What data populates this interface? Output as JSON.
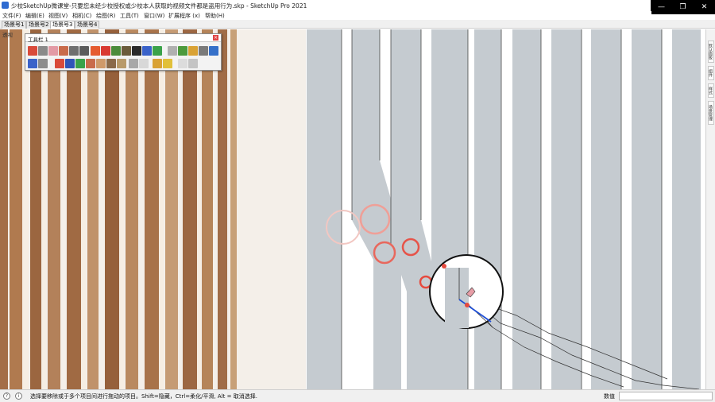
{
  "window": {
    "title": "少校SketchUp微课堂-只要您未经少校授权或少校本人获取的视频文件都是盗用行为.skp - SketchUp Pro 2021",
    "controls": {
      "minimize": "—",
      "restore": "❐",
      "close": "✕"
    }
  },
  "menu": [
    "文件(F)",
    "编辑(E)",
    "视图(V)",
    "相机(C)",
    "绘图(R)",
    "工具(T)",
    "窗口(W)",
    "扩展程序 (x)",
    "帮助(H)"
  ],
  "scene_tabs": [
    {
      "label": "场景号1",
      "active": false
    },
    {
      "label": "场景号2",
      "active": false
    },
    {
      "label": "场景号3",
      "active": true
    },
    {
      "label": "场景号4",
      "active": false
    }
  ],
  "viewport": {
    "perspective_label": "透视"
  },
  "tool_palette": {
    "title": "工具栏 1",
    "close": "×",
    "row1": [
      "select-icon",
      "arc-icon",
      "eraser-icon",
      "paint-icon",
      "rotate-icon",
      "rectangle-icon",
      "push-pull-icon",
      "move-icon",
      "follow-me-icon",
      "offset-icon",
      "tape-icon",
      "protractor-icon",
      "axes-icon",
      "dimension-icon",
      "text-icon",
      "section-icon",
      "orbit-icon",
      "pan-icon"
    ],
    "row2": [
      "component-icon",
      "group-icon",
      "freehand-icon",
      "flip-icon",
      "scale-icon",
      "sandbox-icon",
      "smoove-icon",
      "stamp-icon",
      "drape-icon",
      "add-detail-icon",
      "flip-edge-icon",
      "zoom-extents-icon",
      "style-icon",
      "layers-icon",
      "materials-icon"
    ]
  },
  "right_panel_tabs": [
    "默认面板",
    "组件",
    "样式",
    "场景管理"
  ],
  "statusbar": {
    "hint": "选择要移除或于多个项目间进行拖动的项目。Shift=隐藏，Ctrl=柔化/平滑, Alt = 取消选择.",
    "measurement_label": "数值",
    "measurement_value": ""
  },
  "colors": {
    "board_gray": "#c5cbd0",
    "wood_light": "#c99a6e",
    "wood_dark": "#8a5a36",
    "cursor_red": "#e64a3e",
    "axis_blue": "#1f4fd6"
  }
}
